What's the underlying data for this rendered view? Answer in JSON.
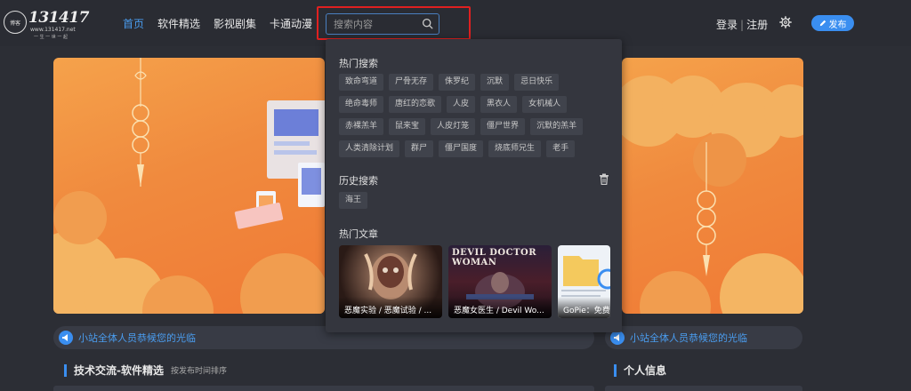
{
  "logo": {
    "number": "131417",
    "url": "www.131417.net",
    "slogan": "一 生 一 世 一 起",
    "badge_text": "博客"
  },
  "nav": {
    "items": [
      "首页",
      "软件精选",
      "影视剧集",
      "卡通动漫"
    ],
    "active_index": 0
  },
  "search": {
    "placeholder": "搜索内容",
    "value": ""
  },
  "header_right": {
    "login": "登录",
    "register": "注册",
    "separator": "|",
    "publish_label": "发布"
  },
  "dropdown": {
    "hot_search_heading": "热门搜索",
    "hot_tags": [
      "致命弯道",
      "尸骨无存",
      "侏罗纪",
      "沉默",
      "忌日快乐",
      "绝命毒师",
      "唐红的恋歌",
      "人皮",
      "黑衣人",
      "女机械人",
      "赤裸羔羊",
      "鼠来宝",
      "人皮灯笼",
      "僵尸世界",
      "沉默的羔羊",
      "人类清除计划",
      "群尸",
      "僵尸国度",
      "烧底师兄生",
      "老手"
    ],
    "history_heading": "历史搜索",
    "history_tags": [
      "海王"
    ],
    "hot_articles_heading": "热门文章",
    "articles": [
      {
        "caption": "恶魔实验 / 恶魔试验 / ...",
        "poster_title": ""
      },
      {
        "caption": "恶魔女医生 / Devil Wo...",
        "poster_title": "DEVIL DOCTOR WOMAN"
      },
      {
        "caption": "GoPie：免费",
        "poster_title": ""
      }
    ]
  },
  "notice": {
    "left_text": "小站全体人员恭候您的光临",
    "right_text": "小站全体人员恭候您的光临"
  },
  "sections": {
    "left_title": "技术交流-软件精选",
    "left_sub": "按发布时间排序",
    "right_title": "个人信息"
  },
  "colors": {
    "accent": "#3a8ef0",
    "background": "#2c2e35",
    "highlight_border": "#e02020",
    "banner": "#f08a3e"
  },
  "icons": {
    "search": "search-icon",
    "settings": "gear-icon",
    "publish": "pencil-icon",
    "trash": "trash-icon",
    "notice": "megaphone-icon"
  }
}
